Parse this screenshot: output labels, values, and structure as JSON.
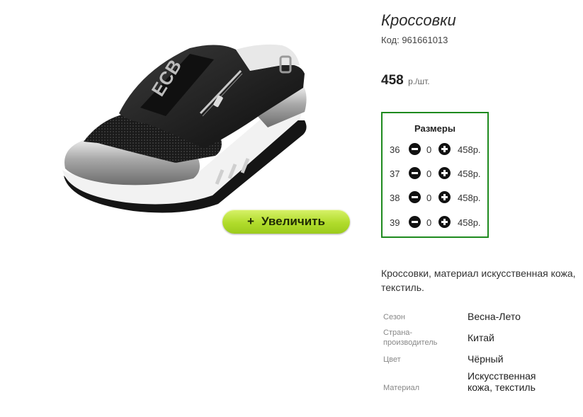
{
  "product": {
    "title": "Кроссовки",
    "code": "Код: 961661013",
    "price_amount": "458",
    "price_unit": "р./шт.",
    "zoom_button_plus": "+",
    "zoom_button_label": "Увеличить",
    "image_icon": "sneaker-photo"
  },
  "sizes": {
    "title": "Размеры",
    "rows": [
      {
        "size": "36",
        "qty": "0",
        "price": "458р."
      },
      {
        "size": "37",
        "qty": "0",
        "price": "458р."
      },
      {
        "size": "38",
        "qty": "0",
        "price": "458р."
      },
      {
        "size": "39",
        "qty": "0",
        "price": "458р."
      }
    ],
    "accent_color": "#1e8a1e"
  },
  "description": "Кроссовки, материал искусственная кожа, текстиль.",
  "attributes": [
    {
      "label": "Сезон",
      "value": "Весна-Лето"
    },
    {
      "label": "Страна-производитель",
      "value": "Китай"
    },
    {
      "label": "Цвет",
      "value": "Чёрный"
    },
    {
      "label": "Материал",
      "value": "Искусственная кожа, текстиль"
    }
  ]
}
